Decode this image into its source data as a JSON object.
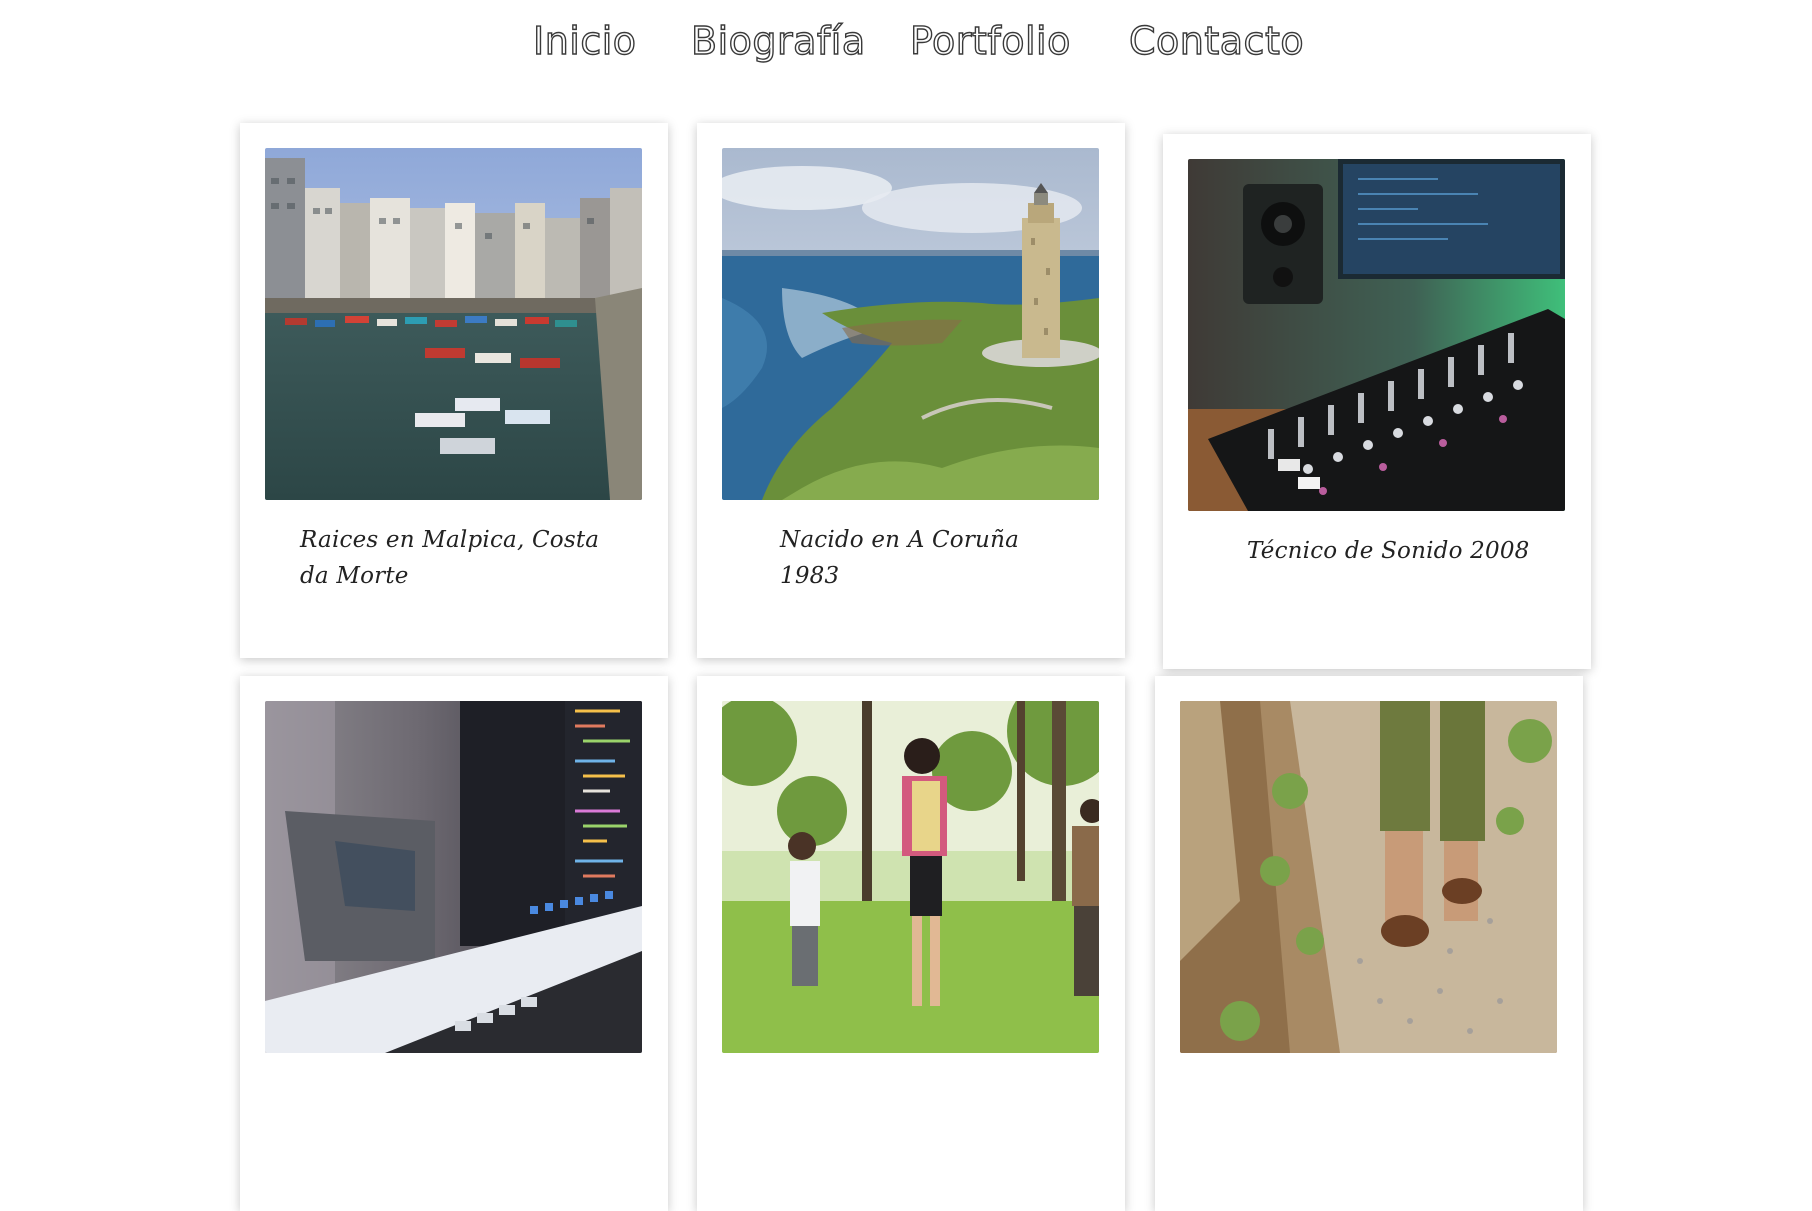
{
  "nav": {
    "items": [
      {
        "label": "Inicio"
      },
      {
        "label": "Biografía"
      },
      {
        "label": "Portfolio"
      },
      {
        "label": "Contacto"
      }
    ]
  },
  "cards": [
    {
      "caption": "Raices en Malpica, Costa da Morte",
      "image": "fishing-harbor-photo"
    },
    {
      "caption": "Nacido en A Coruña 1983",
      "image": "lighthouse-coast-photo"
    },
    {
      "caption": "Técnico de Sonido 2008",
      "image": "audio-mixer-photo"
    },
    {
      "caption": "",
      "image": "laptop-code-photo"
    },
    {
      "caption": "",
      "image": "people-park-photo"
    },
    {
      "caption": "",
      "image": "walking-path-photo"
    }
  ]
}
